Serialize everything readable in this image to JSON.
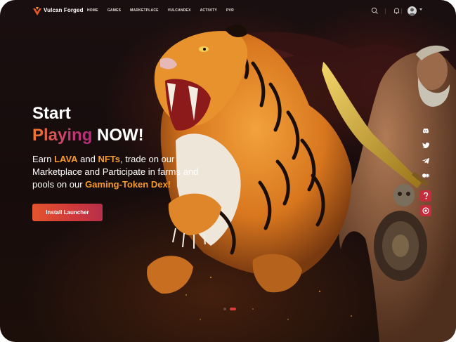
{
  "brand": {
    "name": "Vulcan Forged"
  },
  "nav": {
    "items": [
      "HOME",
      "GAMES",
      "MARKETPLACE",
      "VULCANDEX",
      "ACTIVITY",
      "PVR"
    ]
  },
  "hero": {
    "title_line1": "Start",
    "title_playing": "Playing",
    "title_now": " NOW!",
    "desc": {
      "p1": "Earn ",
      "lava": "LAVA",
      "p2": " and ",
      "nfts": "NFTs",
      "p3": ", trade on our Marketplace and Participate in farms and pools on our ",
      "dex": "Gaming-Token Dex!"
    },
    "cta_label": "Install Launcher"
  },
  "icons": {
    "search": "search-icon",
    "bell": "bell-icon",
    "social": [
      "discord-icon",
      "twitter-icon",
      "telegram-icon",
      "medium-icon",
      "help-icon",
      "support-icon"
    ]
  },
  "colors": {
    "accent_orange": "#f59a2c",
    "cta_red": "#d23a3a",
    "social_red": "#c52d3d",
    "background": "#170c0c"
  },
  "carousel": {
    "active_index": 1,
    "count": 2
  }
}
